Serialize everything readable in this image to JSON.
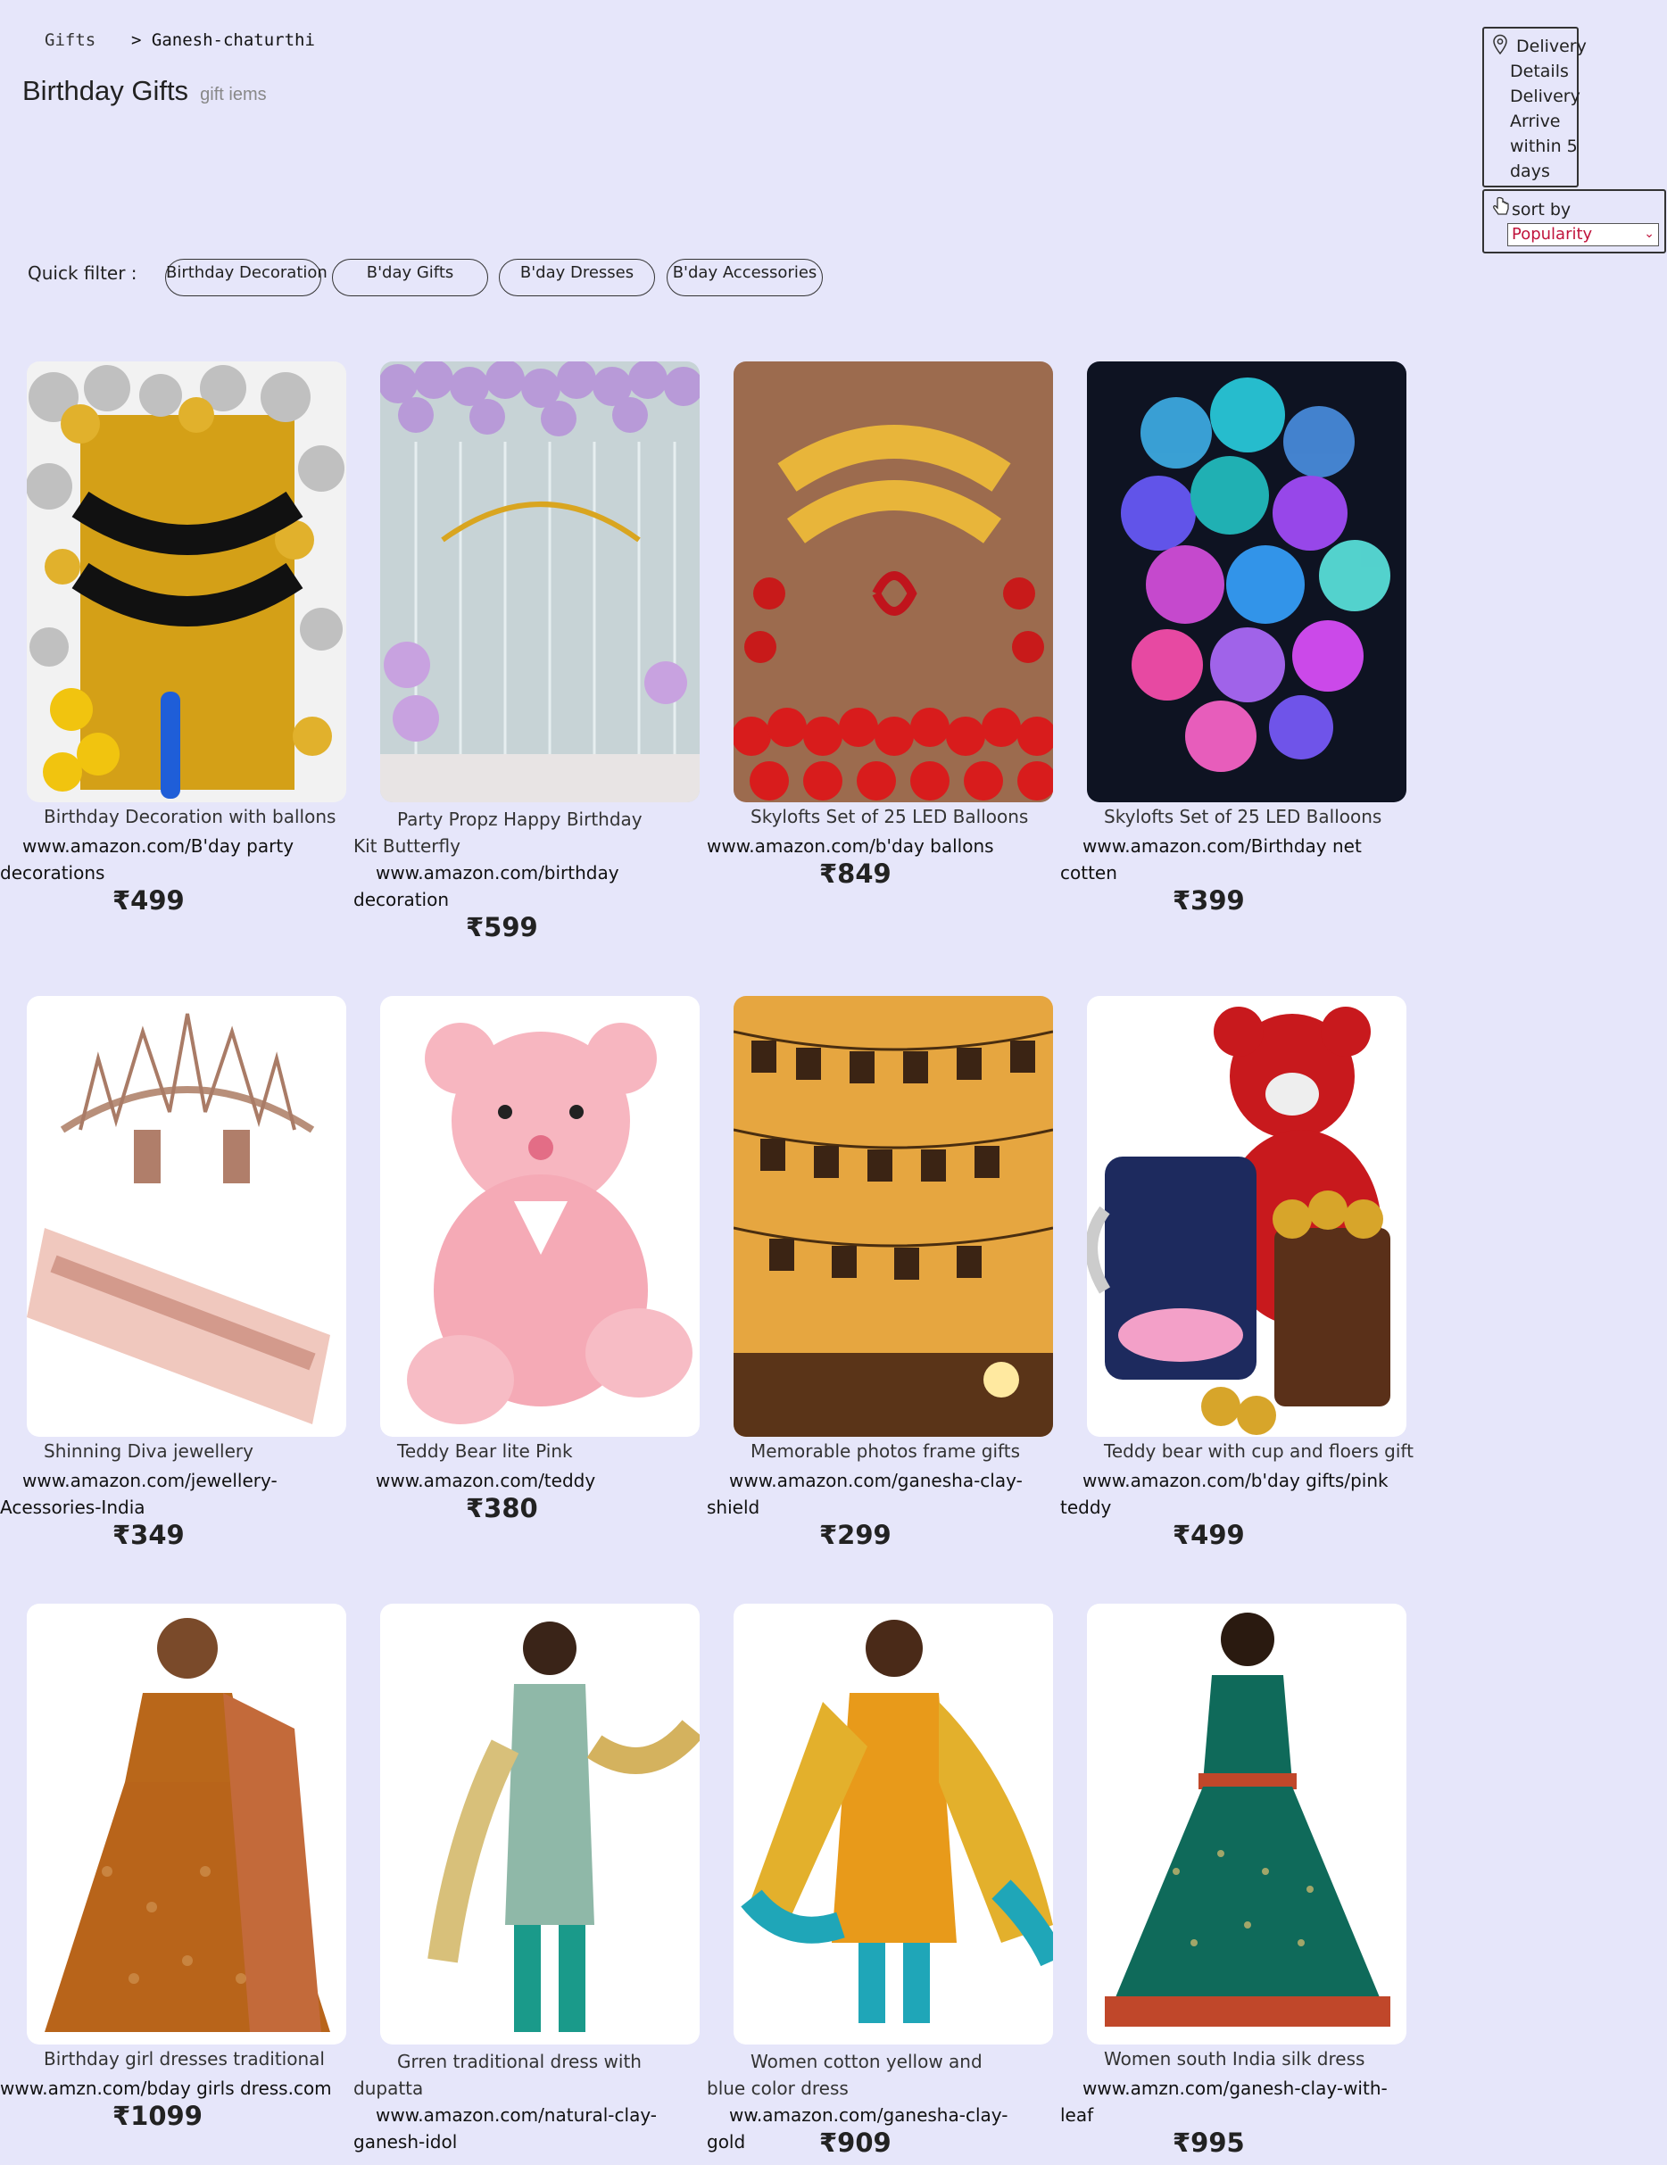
{
  "breadcrumb": {
    "root": "Gifts",
    "current": "> Ganesh-chaturthi"
  },
  "page": {
    "title": "Birthday Gifts",
    "subtitle": "gift iems"
  },
  "delivery": {
    "lines": [
      "Delivery",
      "Details",
      "Delivery",
      "Arrive",
      "within 5",
      "days"
    ]
  },
  "sort": {
    "label": "sort by",
    "selected": "Popularity"
  },
  "filters": {
    "label": "Quick filter :",
    "chips": [
      "Birthday Decoration",
      "B'day Gifts",
      "B'day Dresses",
      "B'day Accessories"
    ]
  },
  "products": [
    {
      "name": "Birthday Decoration with ballons",
      "url": "www.amazon.com/B'day party decorations",
      "price": "₹499"
    },
    {
      "name": "Party Propz Happy Birthday Kit Butterfly",
      "url": "www.amazon.com/birthday decoration",
      "price": "₹599"
    },
    {
      "name": "Skylofts Set of 25 LED Balloons",
      "url": "www.amazon.com/b'day ballons",
      "price": "₹849"
    },
    {
      "name": "Skylofts Set of 25 LED Balloons",
      "url": "www.amazon.com/Birthday net cotten",
      "price": "₹399"
    },
    {
      "name": "Shinning Diva jewellery",
      "url": "www.amazon.com/jewellery-Acessories-India",
      "price": "₹349"
    },
    {
      "name": "Teddy Bear lite Pink",
      "url": "www.amazon.com/teddy",
      "price": "₹380"
    },
    {
      "name": "Memorable photos frame gifts",
      "url": "www.amazon.com/ganesha-clay-shield",
      "price": "₹299"
    },
    {
      "name": "Teddy bear with cup and floers gift",
      "url": "www.amazon.com/b'day gifts/pink teddy",
      "price": "₹499"
    },
    {
      "name": "Birthday girl dresses traditional",
      "url": "www.amzn.com/bday girls dress.com",
      "price": "₹1099"
    },
    {
      "name": "Grren traditional dress with dupatta",
      "url": "www.amazon.com/natural-clay-ganesh-idol",
      "price": ""
    },
    {
      "name": "Women cotton yellow and blue color dress",
      "url": "ww.amazon.com/ganesha-clay-gold",
      "price": "₹909"
    },
    {
      "name": "Women south India silk dress",
      "url": "www.amzn.com/ganesh-clay-with-leaf",
      "price": "₹995"
    }
  ]
}
